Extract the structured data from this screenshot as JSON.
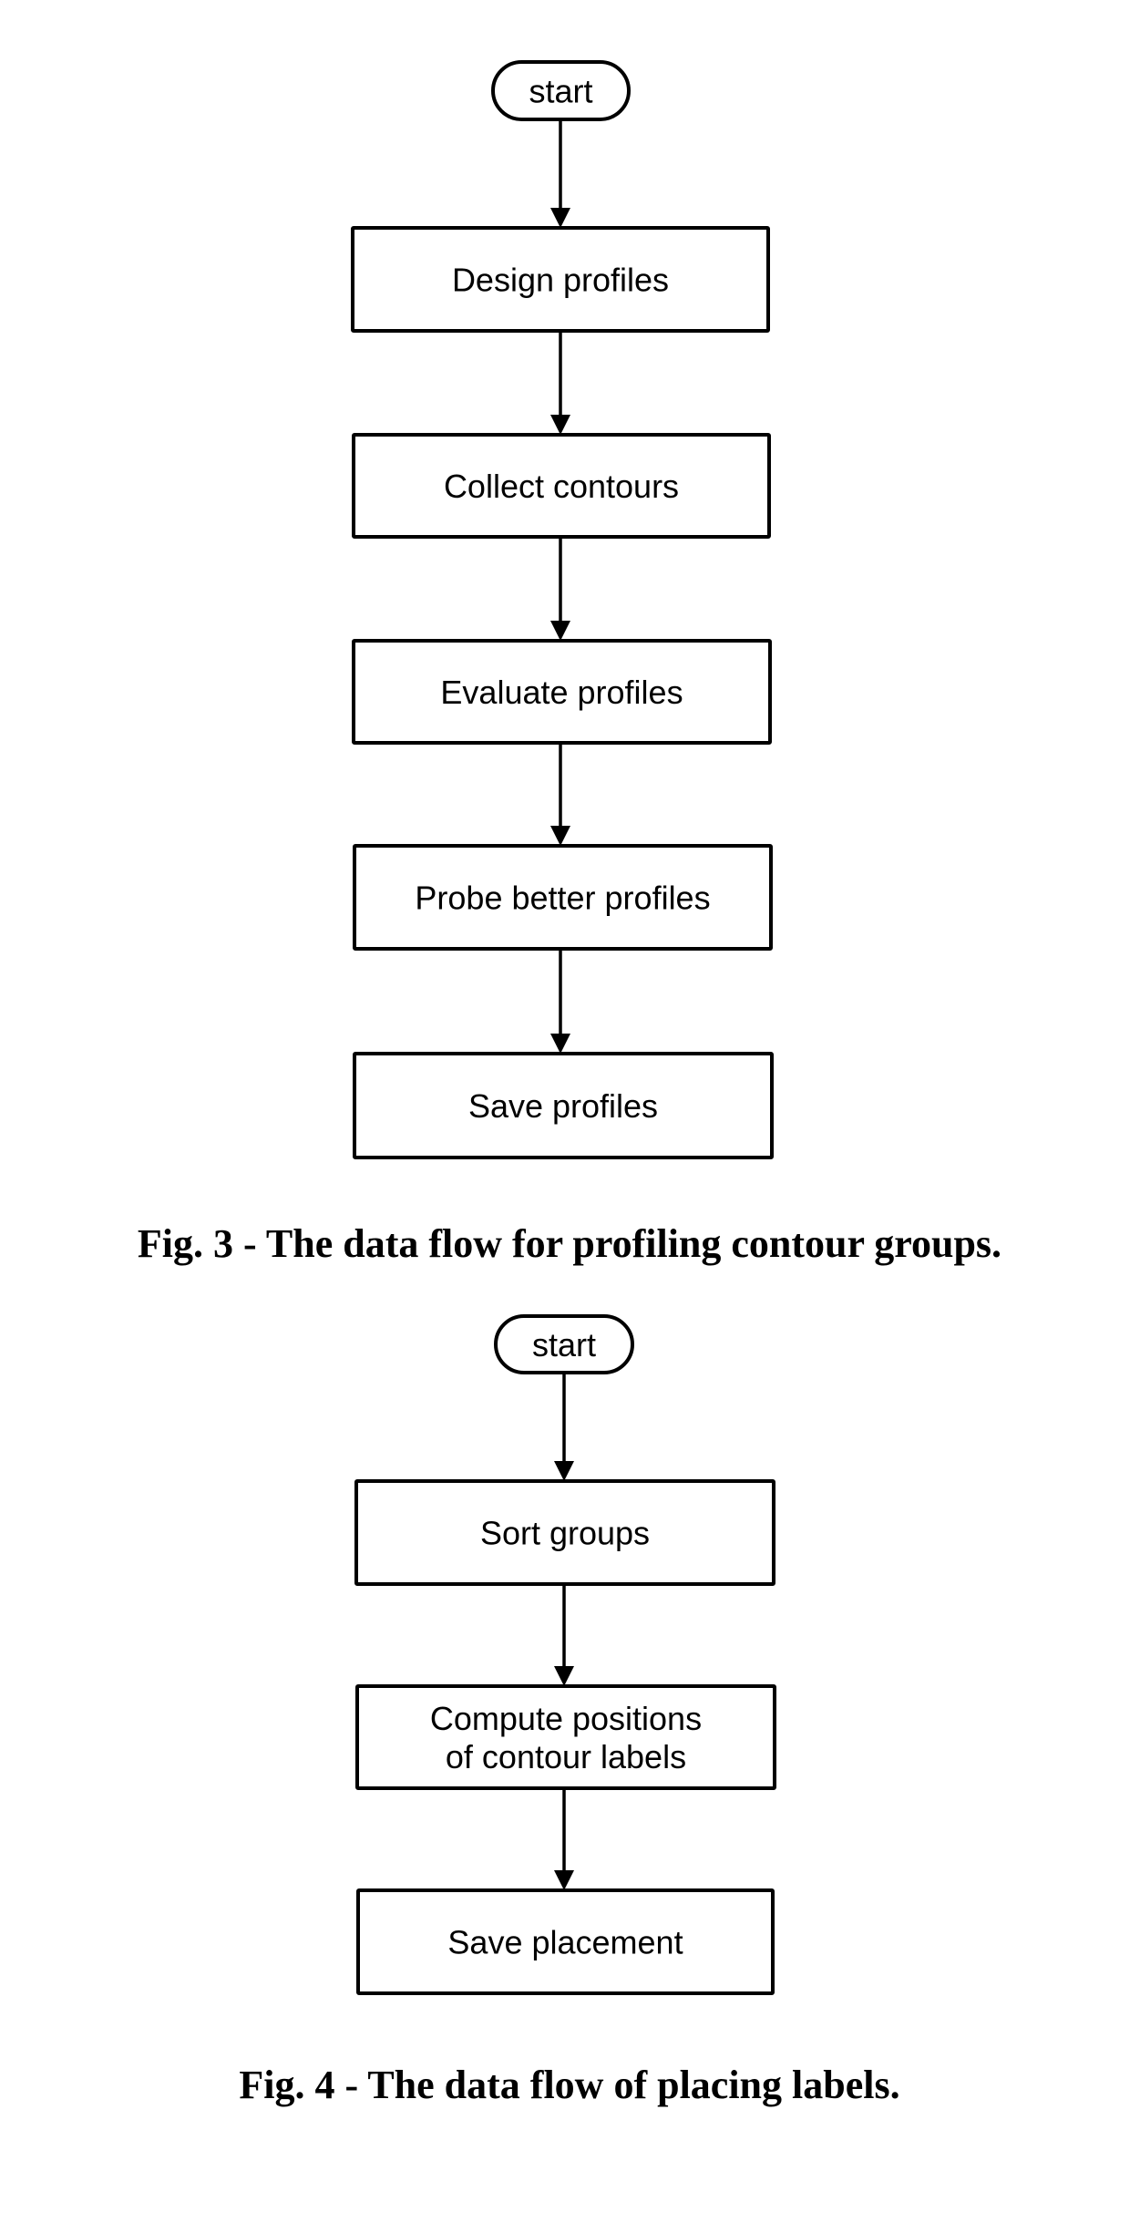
{
  "figures": [
    {
      "id": "fig3",
      "caption": "Fig. 3 - The data flow for profiling contour groups.",
      "nodes": [
        {
          "id": "start",
          "shape": "terminal",
          "lines": [
            "start"
          ]
        },
        {
          "id": "design",
          "shape": "process",
          "lines": [
            "Design profiles"
          ]
        },
        {
          "id": "collect",
          "shape": "process",
          "lines": [
            "Collect contours"
          ]
        },
        {
          "id": "evaluate",
          "shape": "process",
          "lines": [
            "Evaluate profiles"
          ]
        },
        {
          "id": "probe",
          "shape": "process",
          "lines": [
            "Probe better profiles"
          ]
        },
        {
          "id": "save",
          "shape": "process",
          "lines": [
            "Save profiles"
          ]
        }
      ],
      "edges": [
        {
          "from": "start",
          "to": "design"
        },
        {
          "from": "design",
          "to": "collect"
        },
        {
          "from": "collect",
          "to": "evaluate"
        },
        {
          "from": "evaluate",
          "to": "probe"
        },
        {
          "from": "probe",
          "to": "save"
        }
      ]
    },
    {
      "id": "fig4",
      "caption": "Fig. 4 - The data flow of placing labels.",
      "nodes": [
        {
          "id": "start",
          "shape": "terminal",
          "lines": [
            "start"
          ]
        },
        {
          "id": "sort",
          "shape": "process",
          "lines": [
            "Sort groups"
          ]
        },
        {
          "id": "compute",
          "shape": "process",
          "lines": [
            "Compute positions",
            "of contour labels"
          ]
        },
        {
          "id": "save",
          "shape": "process",
          "lines": [
            "Save placement"
          ]
        }
      ],
      "edges": [
        {
          "from": "start",
          "to": "sort"
        },
        {
          "from": "sort",
          "to": "compute"
        },
        {
          "from": "compute",
          "to": "save"
        }
      ]
    }
  ]
}
